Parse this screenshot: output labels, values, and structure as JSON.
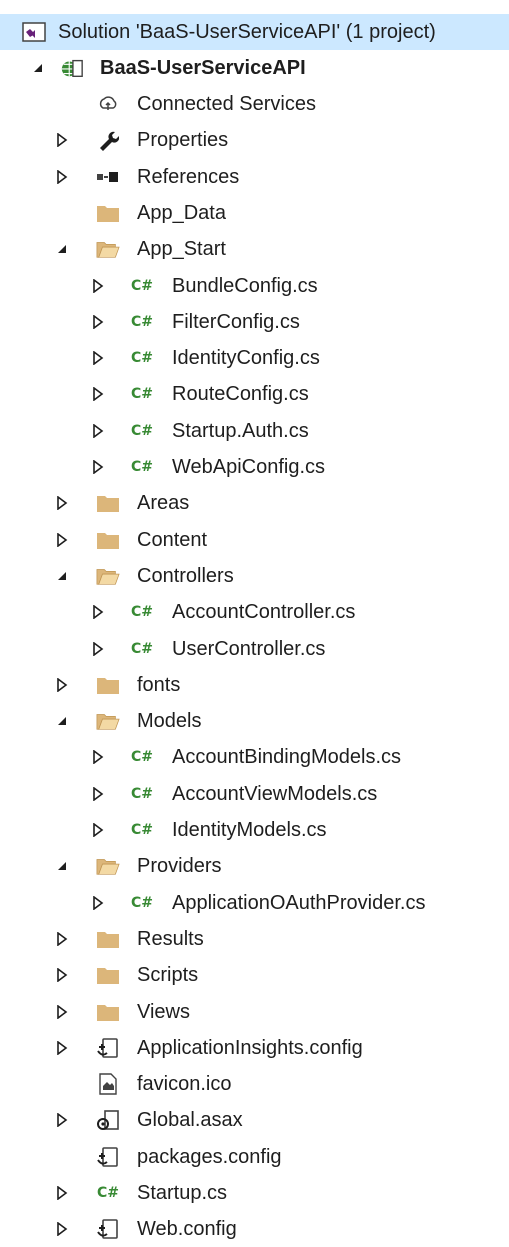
{
  "solution": {
    "label": "Solution 'BaaS-UserServiceAPI' (1 project)"
  },
  "project": {
    "label": "BaaS-UserServiceAPI"
  },
  "items": [
    {
      "label": "Connected Services",
      "icon": "connected-services-icon",
      "expander": "none"
    },
    {
      "label": "Properties",
      "icon": "wrench-icon",
      "expander": "collapsed"
    },
    {
      "label": "References",
      "icon": "references-icon",
      "expander": "collapsed"
    },
    {
      "label": "App_Data",
      "icon": "folder-icon",
      "expander": "none"
    },
    {
      "label": "App_Start",
      "icon": "folder-open-icon",
      "expander": "expanded"
    },
    {
      "label": "BundleConfig.cs",
      "icon": "csharp-icon",
      "expander": "collapsed"
    },
    {
      "label": "FilterConfig.cs",
      "icon": "csharp-icon",
      "expander": "collapsed"
    },
    {
      "label": "IdentityConfig.cs",
      "icon": "csharp-icon",
      "expander": "collapsed"
    },
    {
      "label": "RouteConfig.cs",
      "icon": "csharp-icon",
      "expander": "collapsed"
    },
    {
      "label": "Startup.Auth.cs",
      "icon": "csharp-icon",
      "expander": "collapsed"
    },
    {
      "label": "WebApiConfig.cs",
      "icon": "csharp-icon",
      "expander": "collapsed"
    },
    {
      "label": "Areas",
      "icon": "folder-icon",
      "expander": "collapsed"
    },
    {
      "label": "Content",
      "icon": "folder-icon",
      "expander": "collapsed"
    },
    {
      "label": "Controllers",
      "icon": "folder-open-icon",
      "expander": "expanded"
    },
    {
      "label": "AccountController.cs",
      "icon": "csharp-icon",
      "expander": "collapsed"
    },
    {
      "label": "UserController.cs",
      "icon": "csharp-icon",
      "expander": "collapsed"
    },
    {
      "label": "fonts",
      "icon": "folder-icon",
      "expander": "collapsed"
    },
    {
      "label": "Models",
      "icon": "folder-open-icon",
      "expander": "expanded"
    },
    {
      "label": "AccountBindingModels.cs",
      "icon": "csharp-icon",
      "expander": "collapsed"
    },
    {
      "label": "AccountViewModels.cs",
      "icon": "csharp-icon",
      "expander": "collapsed"
    },
    {
      "label": "IdentityModels.cs",
      "icon": "csharp-icon",
      "expander": "collapsed"
    },
    {
      "label": "Providers",
      "icon": "folder-open-icon",
      "expander": "expanded"
    },
    {
      "label": "ApplicationOAuthProvider.cs",
      "icon": "csharp-icon",
      "expander": "collapsed"
    },
    {
      "label": "Results",
      "icon": "folder-icon",
      "expander": "collapsed"
    },
    {
      "label": "Scripts",
      "icon": "folder-icon",
      "expander": "collapsed"
    },
    {
      "label": "Views",
      "icon": "folder-icon",
      "expander": "collapsed"
    },
    {
      "label": "ApplicationInsights.config",
      "icon": "config-icon",
      "expander": "collapsed"
    },
    {
      "label": "favicon.ico",
      "icon": "image-file-icon",
      "expander": "none"
    },
    {
      "label": "Global.asax",
      "icon": "asax-icon",
      "expander": "collapsed"
    },
    {
      "label": "packages.config",
      "icon": "config-icon",
      "expander": "none"
    },
    {
      "label": "Startup.cs",
      "icon": "csharp-icon",
      "expander": "collapsed"
    },
    {
      "label": "Web.config",
      "icon": "config-icon",
      "expander": "collapsed"
    }
  ],
  "colors": {
    "selection": "#cce8ff",
    "folder": "#dcb67a",
    "csharp": "#388a34",
    "solution": "#68217a",
    "project_globe": "#388a34"
  }
}
